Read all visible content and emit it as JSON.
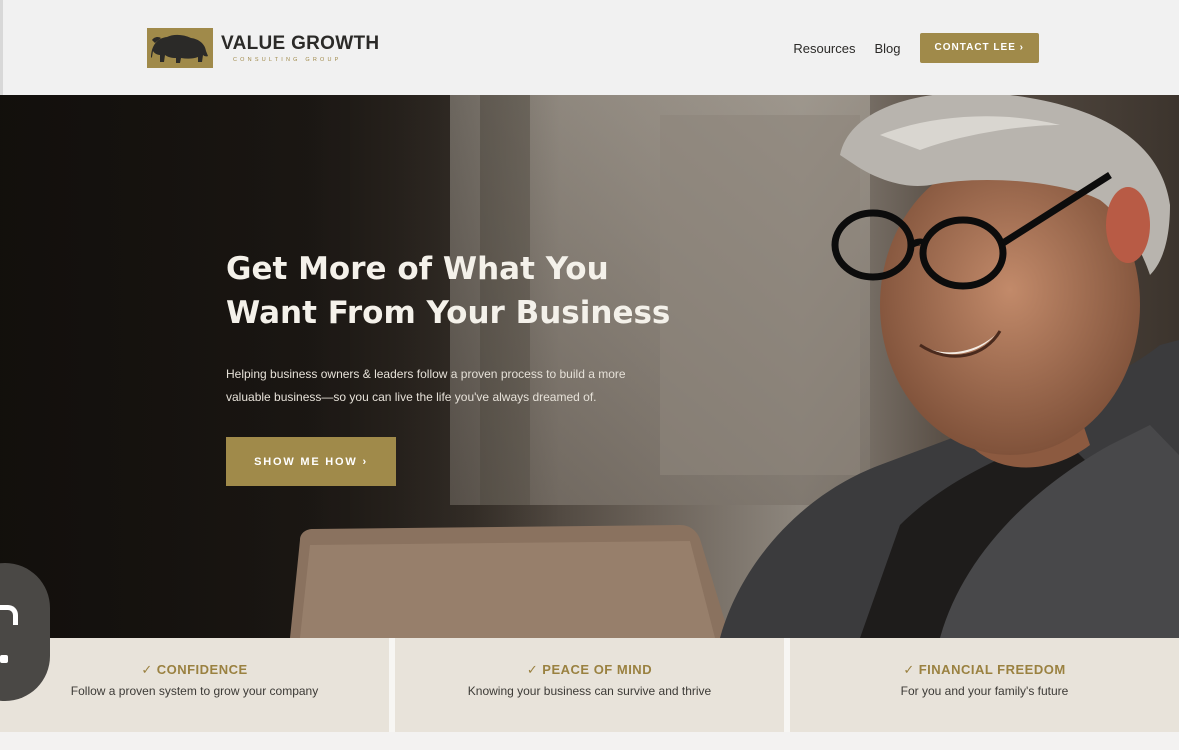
{
  "brand": {
    "name": "VALUE GROWTH",
    "tagline": "CONSULTING GROUP"
  },
  "nav": {
    "items": [
      {
        "label": "Resources"
      },
      {
        "label": "Blog"
      }
    ],
    "cta_label": "CONTACT LEE ›"
  },
  "hero": {
    "title_line1": "Get More of What You",
    "title_line2": "Want From Your Business",
    "subtitle_line1": "Helping business owners & leaders follow a proven process to build a more",
    "subtitle_line2": "valuable business—so you can live the life you've always dreamed of.",
    "cta_label": "SHOW ME HOW ›"
  },
  "features": [
    {
      "check": "✓",
      "title": "CONFIDENCE",
      "desc": "Follow a proven system to grow your company"
    },
    {
      "check": "✓",
      "title": "PEACE OF MIND",
      "desc": "Knowing your business can survive and thrive"
    },
    {
      "check": "✓",
      "title": "FINANCIAL FREEDOM",
      "desc": "For you and your family's future"
    }
  ],
  "colors": {
    "accent_gold": "#a08a4a",
    "dark_text": "#2b2a28",
    "feature_bg": "#e8e3da"
  },
  "icons": {
    "logo": "bison-icon",
    "check": "check-icon"
  }
}
